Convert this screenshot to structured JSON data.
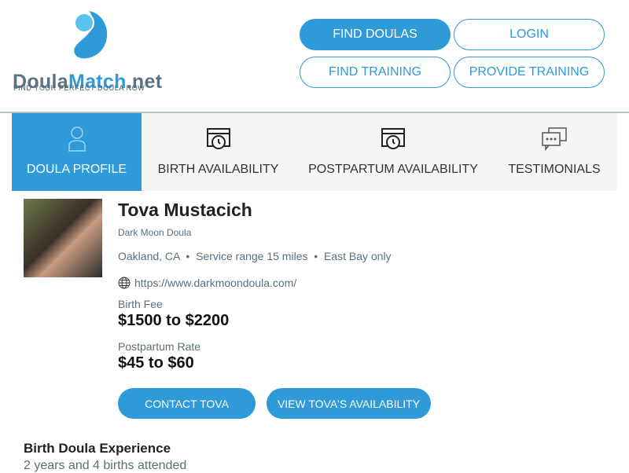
{
  "logo": {
    "brand_1": "Doula",
    "brand_2": "Match",
    "brand_3": ".net",
    "tagline": "FIND YOUR PERFECT DOULA NOW"
  },
  "nav": {
    "find_doulas": "FIND DOULAS",
    "login": "LOGIN",
    "find_training": "FIND TRAINING",
    "provide_training": "PROVIDE TRAINING"
  },
  "tabs": [
    {
      "label": "DOULA PROFILE",
      "icon": "person-icon"
    },
    {
      "label": "BIRTH AVAILABILITY",
      "icon": "calendar-clock-icon"
    },
    {
      "label": "POSTPARTUM AVAILABILITY",
      "icon": "calendar-clock-icon"
    },
    {
      "label": "TESTIMONIALS",
      "icon": "chat-icon"
    }
  ],
  "profile": {
    "name": "Tova Mustacich",
    "business": "Dark Moon Doula",
    "location": "Oakland, CA",
    "range": "Service range 15 miles",
    "area": "East Bay only",
    "website": "https://www.darkmoondoula.com/",
    "birth_fee_label": "Birth Fee",
    "birth_fee": "$1500 to $2200",
    "pp_label": "Postpartum Rate",
    "pp_rate": "$45 to $60",
    "contact": "CONTACT TOVA",
    "availability": "VIEW TOVA'S AVAILABILITY"
  },
  "experience": {
    "title": "Birth Doula Experience",
    "text": "2 years and 4 births attended"
  }
}
